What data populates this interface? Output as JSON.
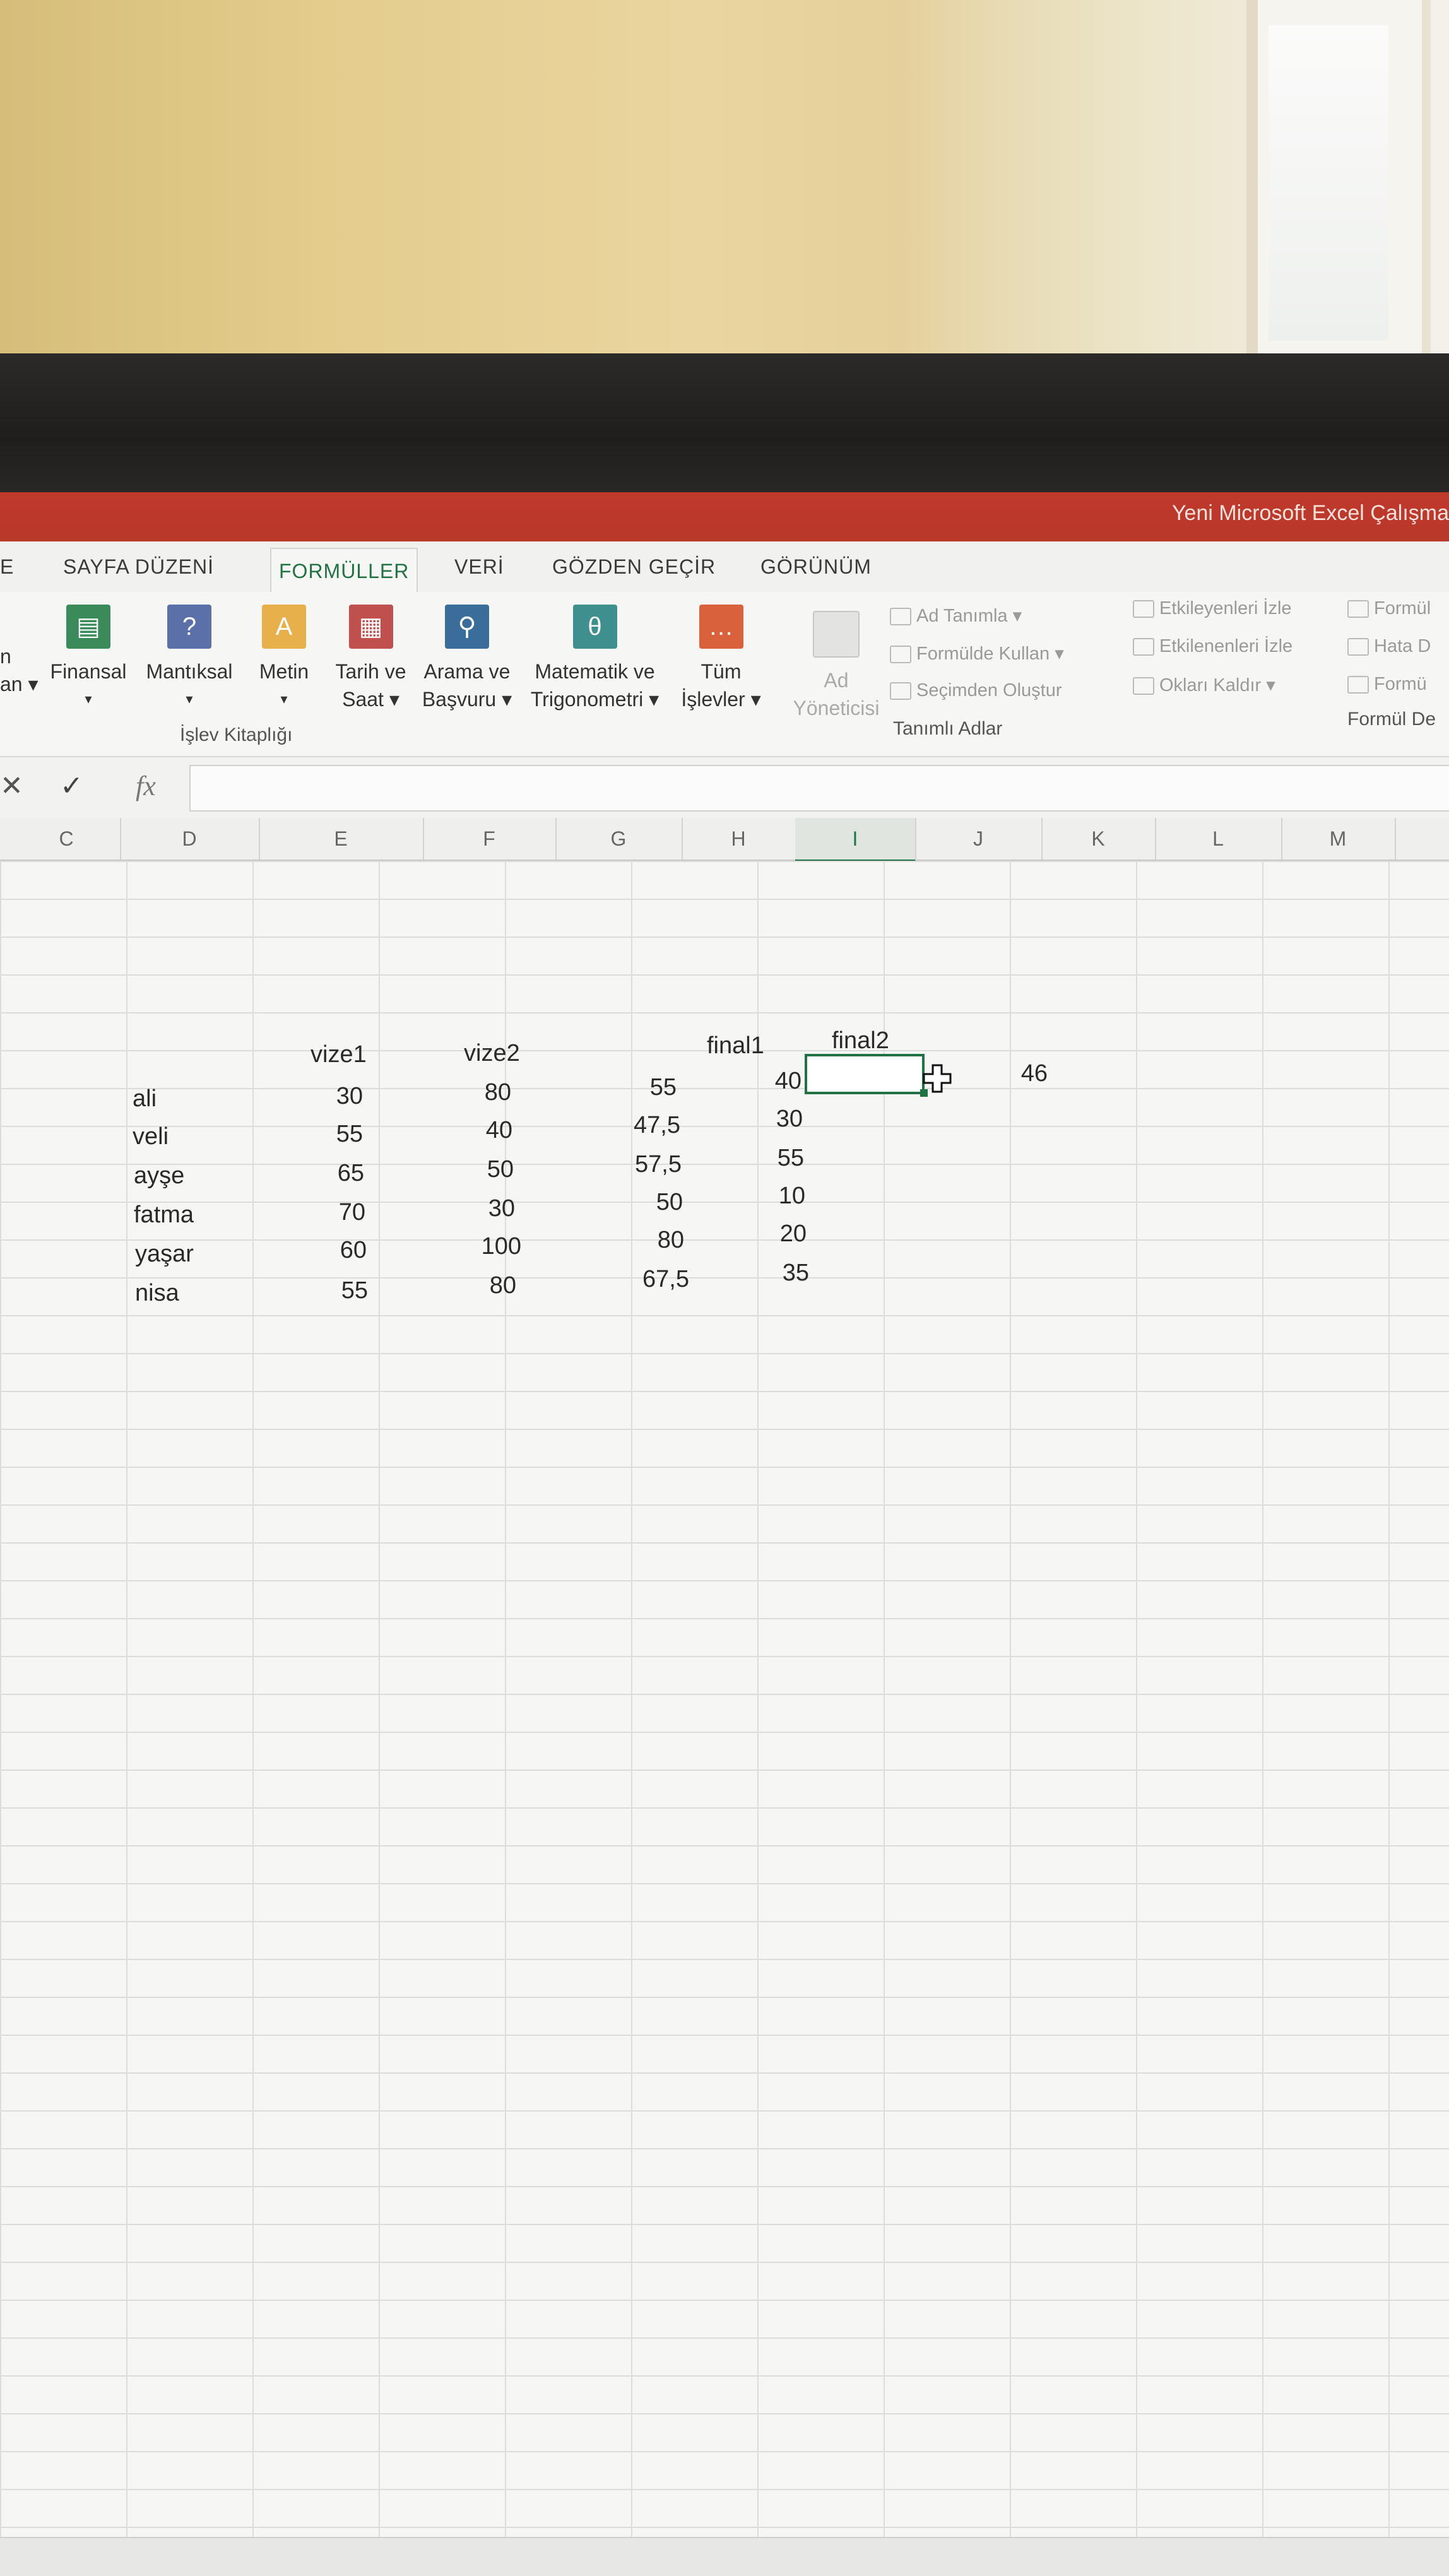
{
  "app": {
    "title": "Yeni Microsoft Excel Çalışma"
  },
  "tabs": [
    {
      "label": "E"
    },
    {
      "label": "SAYFA DÜZENİ"
    },
    {
      "label": "FORMÜLLER"
    },
    {
      "label": "VERİ"
    },
    {
      "label": "GÖZDEN GEÇİR"
    },
    {
      "label": "GÖRÜNÜM"
    }
  ],
  "ribbon": {
    "cut_left": {
      "line1": "n",
      "line2": "an ▾"
    },
    "buttons": [
      {
        "line1": "Finansal",
        "line2": "▾",
        "icon": "finance-icon",
        "color": "#3b8a5a"
      },
      {
        "line1": "Mantıksal",
        "line2": "▾",
        "icon": "question-icon",
        "color": "#5b6fa8"
      },
      {
        "line1": "Metin",
        "line2": "▾",
        "icon": "text-A-icon",
        "color": "#e8b04a"
      },
      {
        "line1": "Tarih ve",
        "line2": "Saat ▾",
        "icon": "calendar-icon",
        "color": "#c0504d"
      },
      {
        "line1": "Arama ve",
        "line2": "Başvuru ▾",
        "icon": "search-icon",
        "color": "#3a6d9a"
      },
      {
        "line1": "Matematik ve",
        "line2": "Trigonometri ▾",
        "icon": "theta-icon",
        "color": "#3f8f8f"
      },
      {
        "line1": "Tüm",
        "line2": "İşlevler ▾",
        "icon": "ellipsis-icon",
        "color": "#d9613b"
      },
      {
        "line1": "Ad",
        "line2": "Yöneticisi",
        "icon": "name-manager-icon",
        "color": "#cfcfcf"
      }
    ],
    "group_function_library": "İşlev Kitaplığı",
    "group_defined_names": "Tanımlı Adlar",
    "group_formula_auditing": "Formül De",
    "defined_names_cmds": [
      "Ad Tanımla ▾",
      "Formülde Kullan ▾",
      "Seçimden Oluştur"
    ],
    "auditing_cmds": [
      "Etkileyenleri İzle",
      "Etkilenenleri İzle",
      "Okları Kaldır ▾"
    ],
    "auditing_cmds_right": [
      "Formül",
      "Hata D",
      "Formü"
    ]
  },
  "formula_bar": {
    "cancel": "✕",
    "enter": "✓",
    "fx": "fx",
    "value": ""
  },
  "columns": [
    "C",
    "D",
    "E",
    "F",
    "G",
    "H",
    "I",
    "J",
    "K",
    "L",
    "M"
  ],
  "sheet": {
    "headers": {
      "vize1": "vize1",
      "vize2": "vize2",
      "final1": "final1",
      "final2": "final2"
    },
    "rows": [
      {
        "name": "ali",
        "vize1": "30",
        "vize2": "80",
        "g": "55",
        "final1": "40"
      },
      {
        "name": "veli",
        "vize1": "55",
        "vize2": "40",
        "g": "47,5",
        "final1": "30"
      },
      {
        "name": "ayşe",
        "vize1": "65",
        "vize2": "50",
        "g": "57,5",
        "final1": "55"
      },
      {
        "name": "fatma",
        "vize1": "70",
        "vize2": "30",
        "g": "50",
        "final1": "10"
      },
      {
        "name": "yaşar",
        "vize1": "60",
        "vize2": "100",
        "g": "80",
        "final1": "20"
      },
      {
        "name": "nisa",
        "vize1": "55",
        "vize2": "80",
        "g": "67,5",
        "final1": "35"
      }
    ],
    "extra_value": "46"
  }
}
